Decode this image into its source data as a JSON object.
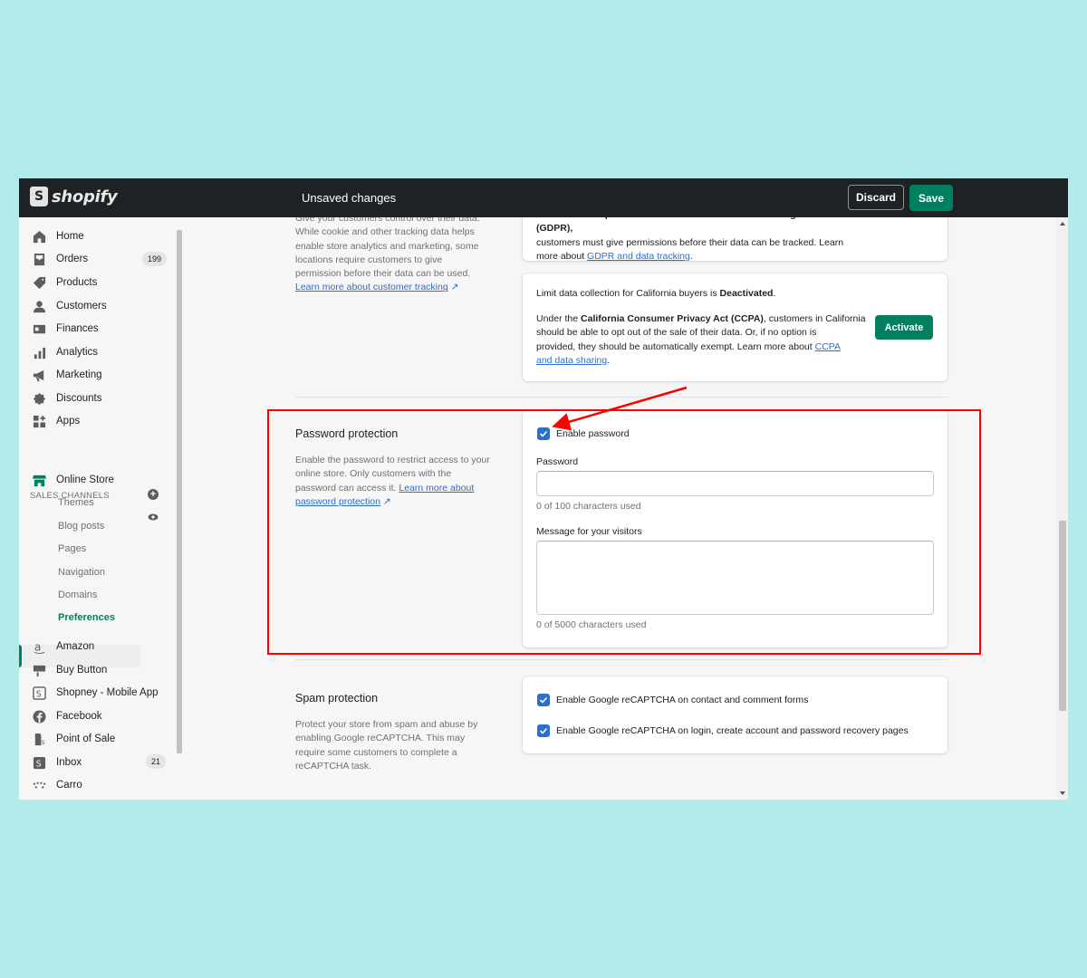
{
  "topbar": {
    "logo_text": "shopify",
    "title": "Unsaved changes",
    "discard_label": "Discard",
    "save_label": "Save"
  },
  "sidebar": {
    "items": [
      {
        "label": "Home",
        "icon": "home-icon"
      },
      {
        "label": "Orders",
        "icon": "orders-icon",
        "badge": "199"
      },
      {
        "label": "Products",
        "icon": "tag-icon"
      },
      {
        "label": "Customers",
        "icon": "person-icon"
      },
      {
        "label": "Finances",
        "icon": "finances-icon"
      },
      {
        "label": "Analytics",
        "icon": "bar-chart-icon"
      },
      {
        "label": "Marketing",
        "icon": "megaphone-icon"
      },
      {
        "label": "Discounts",
        "icon": "discount-icon"
      },
      {
        "label": "Apps",
        "icon": "apps-icon"
      }
    ],
    "sales_channels_title": "SALES CHANNELS",
    "online_store": "Online Store",
    "sub_items": [
      "Themes",
      "Blog posts",
      "Pages",
      "Navigation",
      "Domains",
      "Preferences"
    ],
    "channels": [
      {
        "label": "Amazon",
        "icon": "amazon-icon"
      },
      {
        "label": "Buy Button",
        "icon": "buy-button-icon"
      },
      {
        "label": "Shopney - Mobile App",
        "icon": "shopney-icon"
      },
      {
        "label": "Facebook",
        "icon": "facebook-icon"
      },
      {
        "label": "Point of Sale",
        "icon": "pos-icon"
      },
      {
        "label": "Inbox",
        "icon": "inbox-icon",
        "badge": "21"
      },
      {
        "label": "Carro",
        "icon": "carro-icon"
      }
    ]
  },
  "privacy": {
    "desc_lines": [
      "Give your customers control over their data.",
      "While cookie and other tracking data helps",
      "enable store analytics and marketing, some",
      "locations require customers to give",
      "permission before their data can be used."
    ],
    "learn_more": "Learn more about customer tracking",
    "gdpr_lines": [
      "Under the European Union's General Data Protection Regulation (GDPR),",
      "customers must give permissions before their data can be tracked. Learn",
      "more about"
    ],
    "gdpr_link": "GDPR and data tracking",
    "activate_label": "Activate",
    "ccpa_status_prefix": "Limit data collection for California buyers is ",
    "ccpa_status_value": "Deactivated",
    "ccpa_line1_prefix": "Under the ",
    "ccpa_line1_bold": "California Consumer Privacy Act (CCPA)",
    "ccpa_line1_suffix": ", customers in California",
    "ccpa_line2": "should be able to opt out of the sale of their data. Or, if no option is",
    "ccpa_line3": "provided, they should be automatically exempt. Learn more about",
    "ccpa_link_a": "CCPA",
    "ccpa_link_b": "and data sharing"
  },
  "password_protection": {
    "heading": "Password protection",
    "desc_lines": [
      "Enable the password to restrict access to your",
      "online store. Only customers with the",
      "password can access it."
    ],
    "learn_more_a": "Learn more about",
    "learn_more_b": "password protection",
    "enable_label": "Enable password",
    "enable_checked": true,
    "password_label": "Password",
    "password_value": "",
    "password_count": "0 of 100 characters used",
    "message_label": "Message for your visitors",
    "message_value": "",
    "message_count": "0 of 5000 characters used"
  },
  "spam_protection": {
    "heading": "Spam protection",
    "desc_lines": [
      "Protect your store from spam and abuse by",
      "enabling Google reCAPTCHA. This may",
      "require some customers to complete a",
      "reCAPTCHA task."
    ],
    "option1": "Enable Google reCAPTCHA on contact and comment forms",
    "option2": "Enable Google reCAPTCHA on login, create account and password recovery pages"
  },
  "colors": {
    "accent_green": "#008060",
    "checkbox_blue": "#2c6ecb",
    "annotation_red": "#ff0000",
    "page_background": "#b3ebea"
  }
}
